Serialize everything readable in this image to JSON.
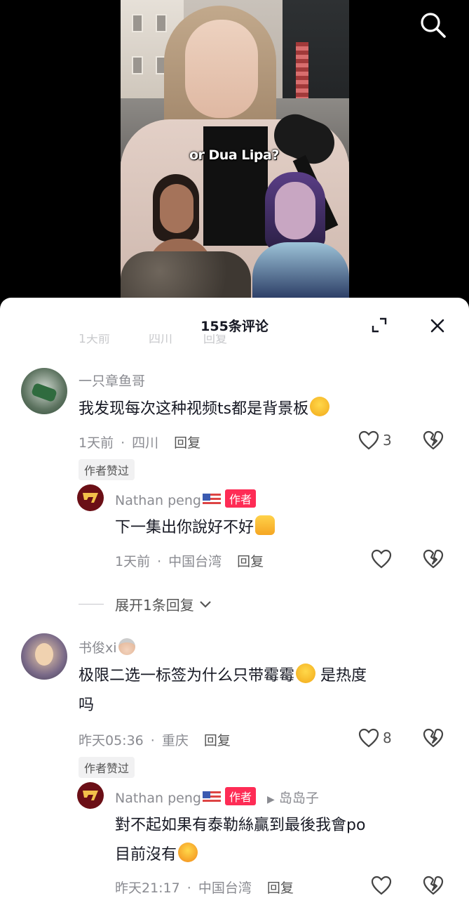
{
  "video": {
    "caption": "or Dua Lipa?"
  },
  "sheet": {
    "title": "155条评论",
    "ghost_row": [
      "1天前",
      "四川",
      "回复"
    ]
  },
  "comments": [
    {
      "nickname": "一只章鱼哥",
      "text": "我发现每次这种视频ts都是背景板",
      "emoji": "rolling-laughing-emoji",
      "time": "1天前",
      "location": "四川",
      "reply_label": "回复",
      "likes": "3",
      "author_liked": "作者赞过",
      "reply": {
        "nickname": "Nathan peng",
        "author_tag": "作者",
        "text": "下一集出你說好不好",
        "emoji": "thumbs-up-emoji",
        "time": "1天前",
        "location": "中国台湾",
        "reply_label": "回复"
      },
      "expand": "展开1条回复"
    },
    {
      "nickname": "书俊xi",
      "text_line1": "极限二选一标签为什么只带霉霉",
      "text_line1_suffix": " 是热度",
      "text_line2": "吗",
      "emoji": "sweat-smile-emoji",
      "time": "昨天05:36",
      "location": "重庆",
      "reply_label": "回复",
      "likes": "8",
      "author_liked": "作者赞过",
      "reply": {
        "nickname": "Nathan peng",
        "author_tag": "作者",
        "reply_to": "岛岛子",
        "text_line1": "對不起如果有泰勒絲贏到最後我會po",
        "text_line2": "目前沒有",
        "emoji": "crying-emoji",
        "time": "昨天21:17",
        "location": "中国台湾",
        "reply_label": "回复"
      }
    }
  ],
  "colors": {
    "primary_text": "#161823",
    "secondary_text": "#8a8b91",
    "author_tag": "#fe2c55"
  }
}
